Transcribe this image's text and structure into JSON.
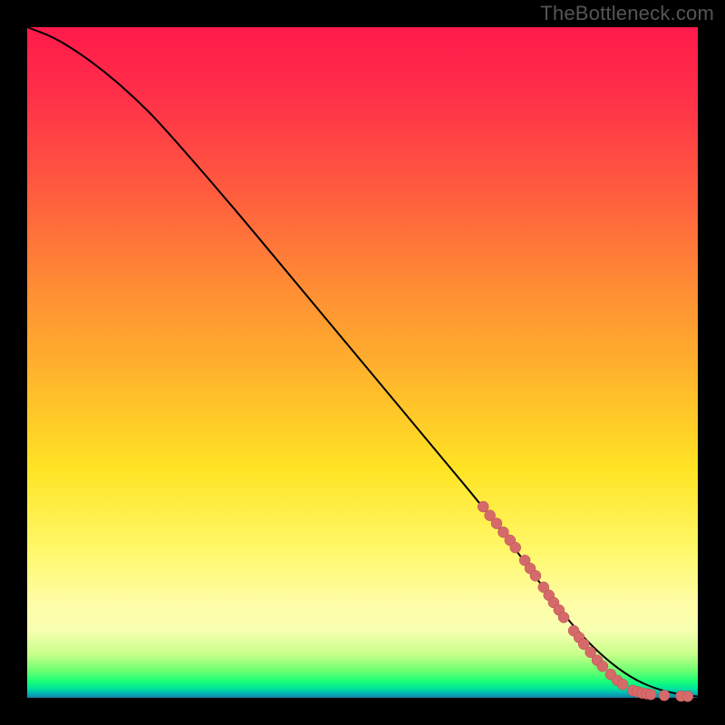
{
  "watermark": "TheBottleneck.com",
  "colors": {
    "background": "#000000",
    "curve_stroke": "#000000",
    "marker_fill": "#d66a6a",
    "marker_stroke": "#b44f4f"
  },
  "chart_data": {
    "type": "line",
    "title": "",
    "xlabel": "",
    "ylabel": "",
    "xlim": [
      0,
      100
    ],
    "ylim": [
      0,
      100
    ],
    "grid": false,
    "legend": false,
    "series": [
      {
        "name": "curve",
        "x": [
          0,
          4,
          8,
          12,
          16,
          20,
          30,
          40,
          50,
          60,
          70,
          78,
          82,
          86,
          90,
          94,
          98,
          100
        ],
        "y": [
          100,
          98.5,
          96,
          93,
          89.5,
          85.5,
          74,
          62,
          50,
          38,
          26,
          15,
          10,
          6,
          3,
          1.2,
          0.4,
          0.2
        ]
      }
    ],
    "markers": [
      {
        "x": 68,
        "y": 28.5
      },
      {
        "x": 69,
        "y": 27.2
      },
      {
        "x": 70,
        "y": 26
      },
      {
        "x": 71,
        "y": 24.7
      },
      {
        "x": 72,
        "y": 23.5
      },
      {
        "x": 72.8,
        "y": 22.4
      },
      {
        "x": 74.2,
        "y": 20.5
      },
      {
        "x": 75,
        "y": 19.3
      },
      {
        "x": 75.8,
        "y": 18.2
      },
      {
        "x": 77,
        "y": 16.5
      },
      {
        "x": 77.8,
        "y": 15.3
      },
      {
        "x": 78.5,
        "y": 14.2
      },
      {
        "x": 79.3,
        "y": 13.1
      },
      {
        "x": 80,
        "y": 12
      },
      {
        "x": 81.5,
        "y": 10
      },
      {
        "x": 82.3,
        "y": 9
      },
      {
        "x": 83,
        "y": 8
      },
      {
        "x": 84,
        "y": 6.8
      },
      {
        "x": 85,
        "y": 5.6
      },
      {
        "x": 85.8,
        "y": 4.7
      },
      {
        "x": 87,
        "y": 3.5
      },
      {
        "x": 88,
        "y": 2.6
      },
      {
        "x": 88.8,
        "y": 2
      },
      {
        "x": 90.3,
        "y": 1.1
      },
      {
        "x": 91,
        "y": 0.9
      },
      {
        "x": 91.7,
        "y": 0.7
      },
      {
        "x": 92.4,
        "y": 0.6
      },
      {
        "x": 93,
        "y": 0.5
      },
      {
        "x": 95,
        "y": 0.35
      },
      {
        "x": 97.5,
        "y": 0.25
      },
      {
        "x": 98.5,
        "y": 0.22
      }
    ]
  }
}
